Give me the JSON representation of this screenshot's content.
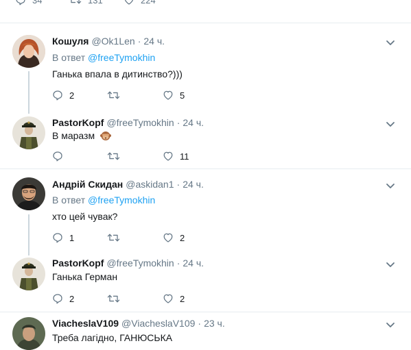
{
  "top_actions": {
    "replies": "34",
    "retweets": "131",
    "likes": "224"
  },
  "tweets": [
    {
      "name": "Кошуля",
      "handle": "@Ok1Len",
      "time": "24 ч.",
      "reply_prefix": "В ответ",
      "reply_to": "@freeTymokhin",
      "text": "Ганька впала в дитинство?)))",
      "replies": "2",
      "retweets": "",
      "likes": "5"
    },
    {
      "name": "PastorKopf",
      "handle": "@freeTymokhin",
      "time": "24 ч.",
      "text": "В маразм",
      "emoji": "see-no-evil-monkey",
      "replies": "",
      "retweets": "",
      "likes": "11"
    },
    {
      "name": "Андрій Скидан",
      "handle": "@askidan1",
      "time": "24 ч.",
      "reply_prefix": "В ответ",
      "reply_to": "@freeTymokhin",
      "text": "хто цей чувак?",
      "replies": "1",
      "retweets": "",
      "likes": "2"
    },
    {
      "name": "PastorKopf",
      "handle": "@freeTymokhin",
      "time": "24 ч.",
      "text": "Ганька Герман",
      "replies": "2",
      "retweets": "",
      "likes": "2"
    },
    {
      "name": "ViacheslaV109",
      "handle": "@ViacheslaV109",
      "time": "23 ч.",
      "text": "Треба лагідно, ГАНЮСЬКА"
    }
  ],
  "colors": {
    "link": "#1da1f2",
    "muted": "#657786",
    "thread_line": "#ccd6dd",
    "divider": "#e6ecf0"
  }
}
